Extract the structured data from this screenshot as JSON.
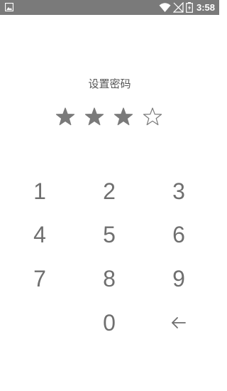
{
  "status_bar": {
    "time": "3:58",
    "icons": [
      "gallery-icon",
      "wifi-icon",
      "signal-icon",
      "battery-icon"
    ]
  },
  "title": "设置密码",
  "pin": {
    "length": 4,
    "filled": 3
  },
  "keypad": {
    "keys": [
      "1",
      "2",
      "3",
      "4",
      "5",
      "6",
      "7",
      "8",
      "9",
      "0"
    ],
    "backspace_icon": "back-arrow-icon"
  },
  "colors": {
    "status_bar": "#7a7a7a",
    "text": "#6f6f6f",
    "star": "#7a7a7a"
  }
}
